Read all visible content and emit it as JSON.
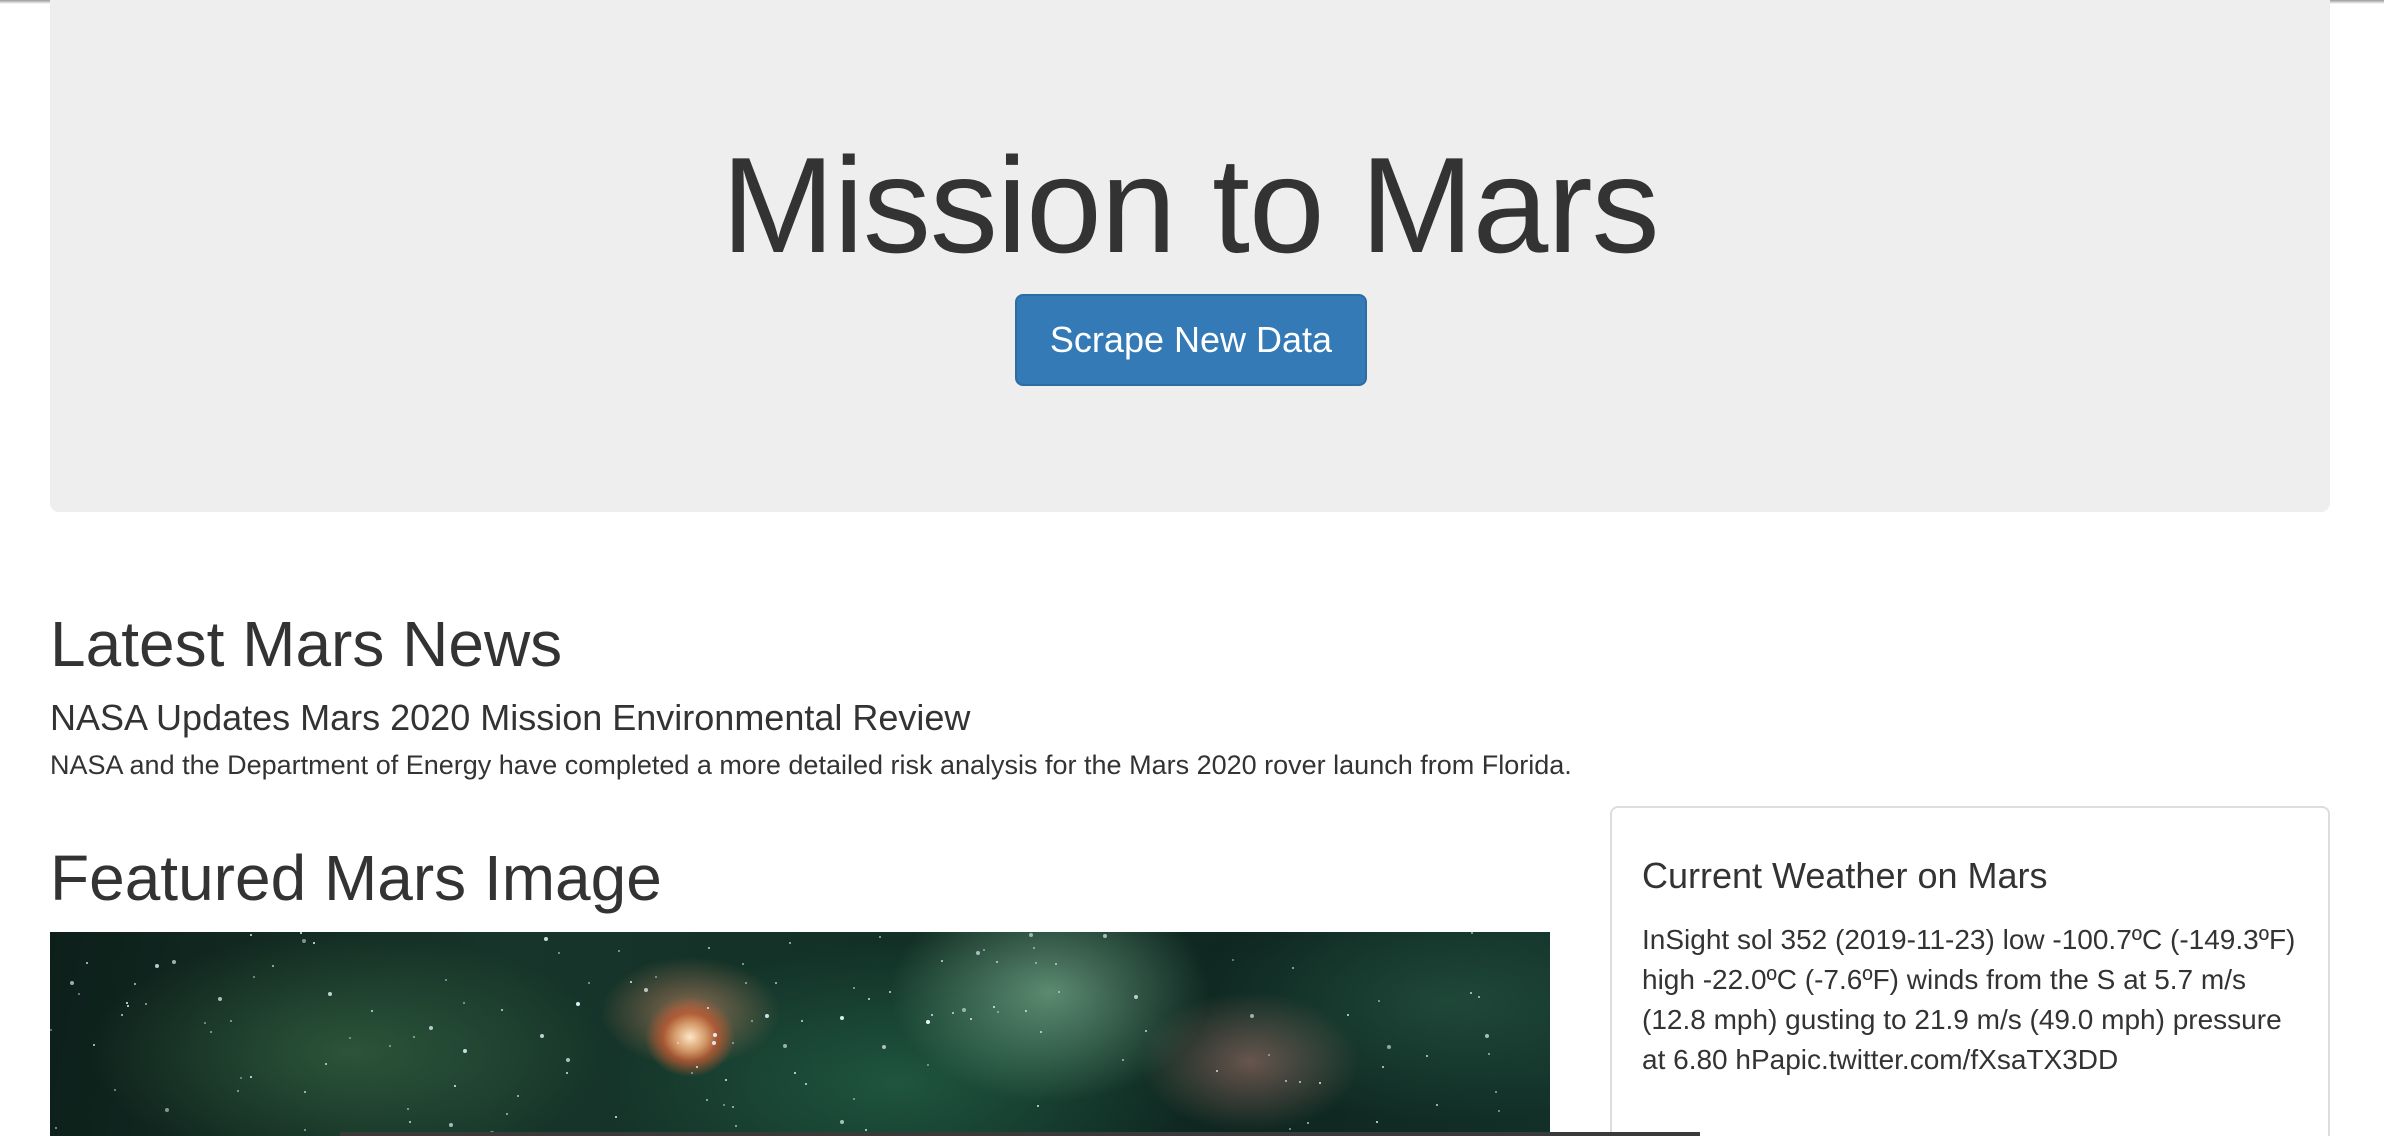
{
  "header": {
    "title": "Mission to Mars",
    "scrape_button_label": "Scrape New Data",
    "button_color": "#337ab7"
  },
  "news": {
    "section_title": "Latest Mars News",
    "headline": "NASA Updates Mars 2020 Mission Environmental Review",
    "teaser": "NASA and the Department of Energy have completed a more detailed risk analysis for the Mars 2020 rover launch from Florida."
  },
  "featured_image": {
    "section_title": "Featured Mars Image"
  },
  "weather": {
    "title": "Current Weather on Mars",
    "text": "InSight sol 352 (2019-11-23) low -100.7ºC (-149.3ºF) high -22.0ºC (-7.6ºF) winds from the S at 5.7 m/s (12.8 mph) gusting to 21.9 m/s (49.0 mph) pressure at 6.80 hPapic.twitter.com/fXsaTX3DD"
  },
  "colors": {
    "jumbotron_bg": "#eeeeee",
    "text": "#333333",
    "card_border": "#dddddd"
  }
}
